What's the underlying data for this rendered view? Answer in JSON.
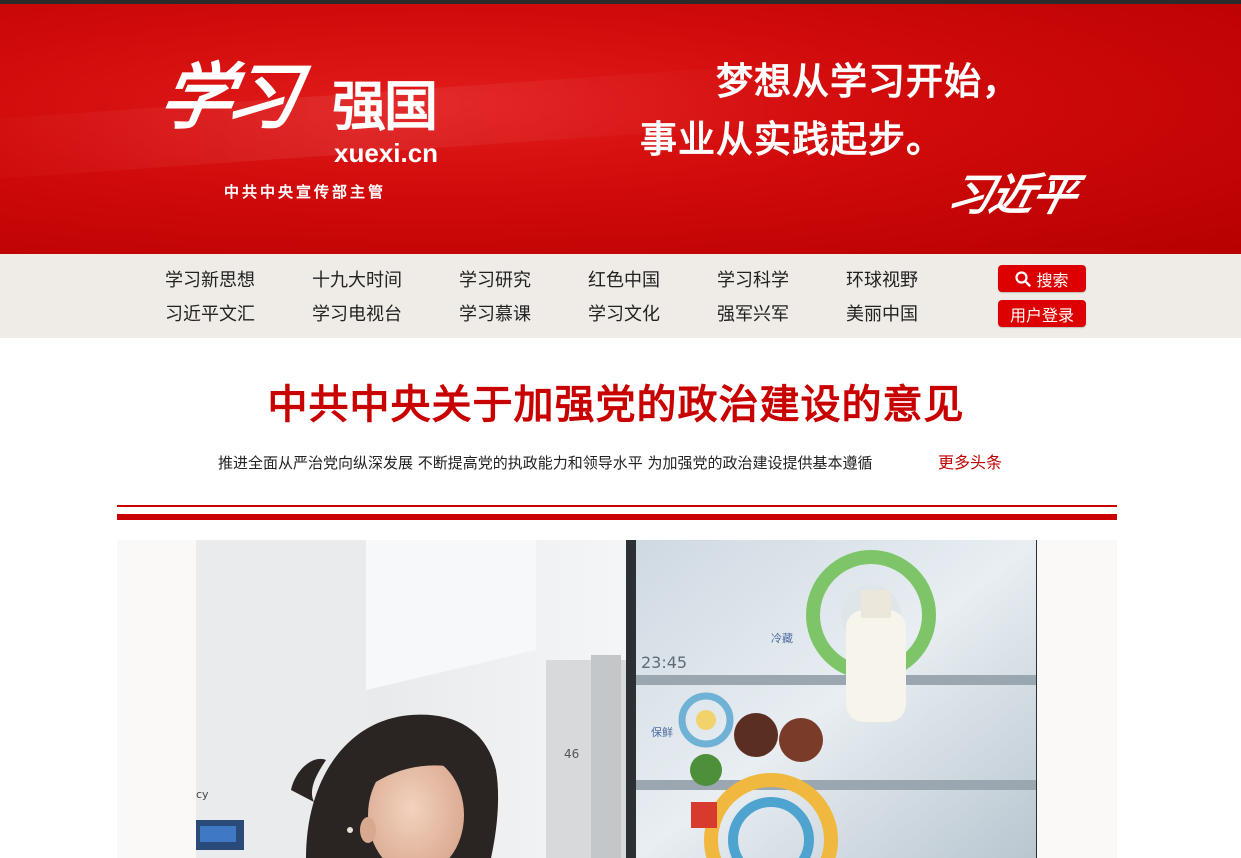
{
  "header": {
    "logo_calligraphy": "学习",
    "logo_text": "强国",
    "domain": "xuexi.cn",
    "supervisor": "中共中央宣传部主管",
    "slogan_line1": "梦想从学习开始，",
    "slogan_line2": "事业从实践起步。",
    "signature": "习近平"
  },
  "nav": {
    "row1": [
      "学习新思想",
      "十九大时间",
      "学习研究",
      "红色中国",
      "学习科学",
      "环球视野"
    ],
    "row2": [
      "习近平文汇",
      "学习电视台",
      "学习慕课",
      "学习文化",
      "强军兴军",
      "美丽中国"
    ],
    "search_label": "搜索",
    "login_label": "用户登录"
  },
  "main": {
    "headline": "中共中央关于加强党的政治建设的意见",
    "subline": "推进全面从严治党向纵深发展  不断提高党的执政能力和领导水平  为加强党的政治建设提供基本遵循",
    "more_label": "更多头条"
  },
  "photo": {
    "screen_time": "23:45",
    "label_a": "保鲜",
    "label_b": "冷藏",
    "label_c": "46",
    "label_d": "cy"
  },
  "colors": {
    "brand_red": "#c90000",
    "banner_red": "#d00a0a",
    "nav_bg": "#efebe6"
  },
  "icons": {
    "search": "search-icon",
    "photo": "smart-fridge-photo"
  }
}
